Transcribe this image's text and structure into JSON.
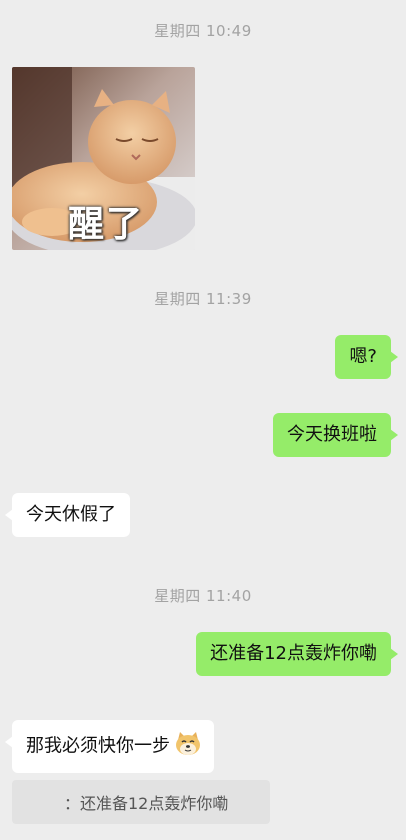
{
  "timestamps": [
    "星期四 10:49",
    "星期四 11:39",
    "星期四 11:40"
  ],
  "sticker": {
    "caption": "醒了"
  },
  "messages": {
    "m1": "嗯?",
    "m2": "今天换班啦",
    "m3": "今天休假了",
    "m4": "还准备12点轰炸你嘞",
    "m5": "那我必须快你一步"
  },
  "quote": {
    "text": "：还准备12点轰炸你嘞"
  },
  "colors": {
    "outgoing": "#95ec69",
    "incoming": "#ffffff",
    "background": "#ededed",
    "timestamp": "#a3a3a3"
  }
}
